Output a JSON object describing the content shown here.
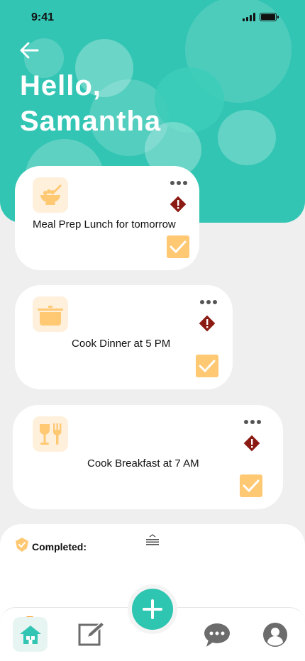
{
  "status_bar": {
    "time": "9:41"
  },
  "header": {
    "greeting": "Hello,\nSamantha"
  },
  "tasks": [
    {
      "title": "Meal Prep Lunch for tomorrow",
      "icon": "food-bowl-icon"
    },
    {
      "title": "Cook Dinner at 5 PM",
      "icon": "cooking-pot-icon"
    },
    {
      "title": "Cook Breakfast at 7 AM",
      "icon": "cutlery-icon"
    }
  ],
  "completed": {
    "label": "Completed:"
  },
  "nav": {
    "items": [
      "home-icon",
      "edit-icon",
      "add-icon",
      "chat-icon",
      "profile-icon"
    ]
  },
  "colors": {
    "accent": "#33c5b3",
    "card_icon_bg": "#fff0dc",
    "icon_orange": "#ffc873",
    "alert": "#8b1a12"
  }
}
